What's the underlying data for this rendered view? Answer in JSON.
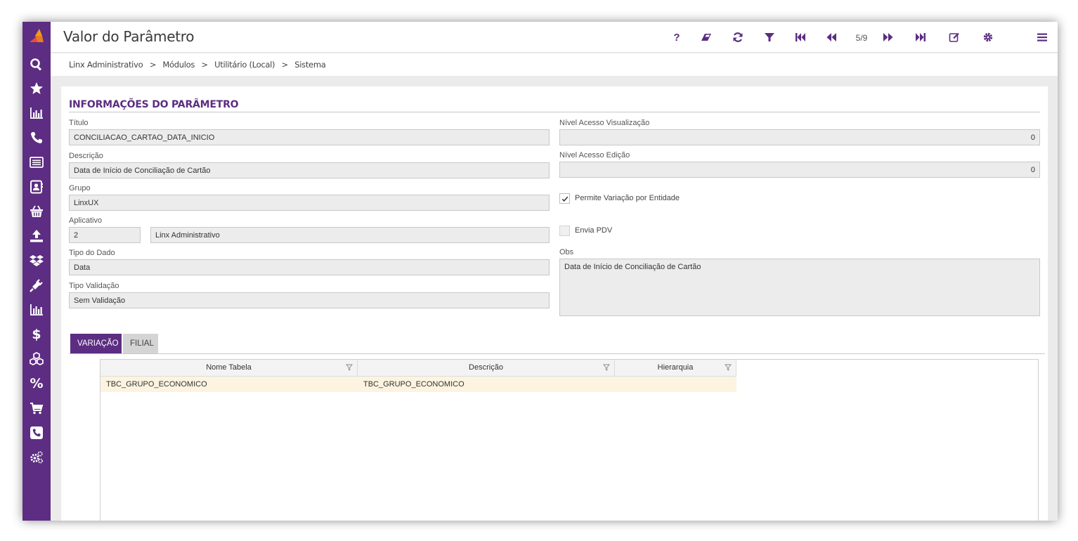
{
  "app": {
    "title": "Valor do Parâmetro",
    "page_indicator": "5/9",
    "accent": "#5c2d82"
  },
  "breadcrumb": [
    "Linx Administrativo",
    ">",
    "Módulos",
    ">",
    "Utilitário (Local)",
    ">",
    "Sistema"
  ],
  "toolbar_icons": [
    "help-icon",
    "eraser-icon",
    "refresh-icon",
    "filter-icon",
    "first-record-icon",
    "previous-record-icon",
    "next-record-icon",
    "last-record-icon",
    "edit-icon",
    "settings-icon",
    "menu-icon"
  ],
  "sidebar_icons": [
    "search-icon",
    "star-icon",
    "bar-chart-icon",
    "phone-icon",
    "list-icon",
    "contact-icon",
    "basket-icon",
    "upload-icon",
    "dropbox-icon",
    "plug-icon",
    "report-icon",
    "dollar-icon",
    "cubes-icon",
    "percent-icon",
    "cart-icon",
    "phone-square-icon",
    "cogs-icon"
  ],
  "section": {
    "title": "INFORMAÇÕES DO PARÂMETRO"
  },
  "form": {
    "titulo_label": "Título",
    "titulo_value": "CONCILIACAO_CARTAO_DATA_INICIO",
    "descricao_label": "Descrição",
    "descricao_value": "Data de Início de Conciliação de Cartão",
    "grupo_label": "Grupo",
    "grupo_value": "LinxUX",
    "aplicativo_label": "Aplicativo",
    "aplicativo_code": "2",
    "aplicativo_name": "Linx Administrativo",
    "tipo_dado_label": "Tipo do Dado",
    "tipo_dado_value": "Data",
    "tipo_validacao_label": "Tipo Validação",
    "tipo_validacao_value": "Sem Validação",
    "nivel_visualizacao_label": "Nível Acesso Visualização",
    "nivel_visualizacao_value": "0",
    "nivel_edicao_label": "Nível Acesso Edição",
    "nivel_edicao_value": "0",
    "permite_variacao_label": "Permite Variação por Entidade",
    "permite_variacao_checked": true,
    "envia_pdv_label": "Envia PDV",
    "envia_pdv_checked": false,
    "obs_label": "Obs",
    "obs_value": "Data de Início de Conciliação de Cartão"
  },
  "tabs": [
    {
      "label": "VARIAÇÃO",
      "active": true
    },
    {
      "label": "FILIAL",
      "active": false
    }
  ],
  "grid": {
    "columns": [
      "Nome Tabela",
      "Descrição",
      "Hierarquia"
    ],
    "rows": [
      [
        "TBC_GRUPO_ECONOMICO",
        "TBC_GRUPO_ECONOMICO",
        ""
      ]
    ]
  }
}
